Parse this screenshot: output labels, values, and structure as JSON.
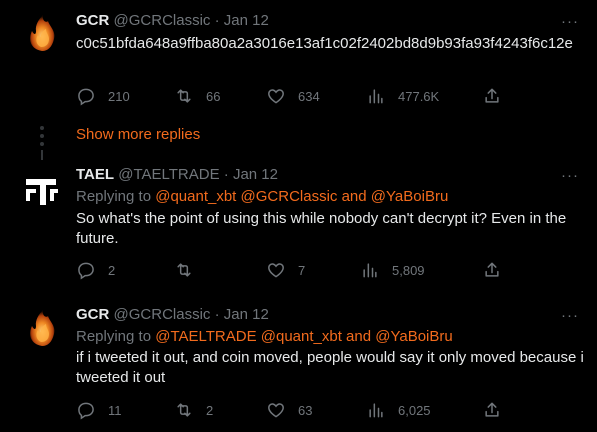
{
  "tweets": [
    {
      "name": "GCR",
      "handle": "@GCRClassic",
      "date": "Jan 12",
      "text": "c0c51bfda648a9ffba80a2a3016e13af1c02f2402bd8d9b93fa93f4243f6c12e",
      "replies": "210",
      "retweets": "66",
      "likes": "634",
      "views": "477.6K"
    },
    {
      "name": "TAEL",
      "handle": "@TAELTRADE",
      "date": "Jan 12",
      "replying_prefix": "Replying to",
      "replying_mention1": "@quant_xbt",
      "replying_mention2": "@GCRClassic",
      "replying_and": "and",
      "replying_mention3": "@YaBoiBru",
      "text": "So what's the point of using this while nobody can't decrypt it? Even in the future.",
      "replies": "2",
      "retweets": "",
      "likes": "7",
      "views": "5,809"
    },
    {
      "name": "GCR",
      "handle": "@GCRClassic",
      "date": "Jan 12",
      "replying_prefix": "Replying to",
      "replying_mention1": "@TAELTRADE",
      "replying_mention2": "@quant_xbt",
      "replying_and": "and",
      "replying_mention3": "@YaBoiBru",
      "text": "if i tweeted it out, and coin moved, people would say it only moved because i tweeted it out",
      "replies": "11",
      "retweets": "2",
      "likes": "63",
      "views": "6,025"
    }
  ],
  "show_more_replies": "Show more replies",
  "dot_separator": "·",
  "more_glyph": "···",
  "colors": {
    "accent": "#f26b1d",
    "muted": "#71767b",
    "text": "#e7e9ea",
    "background": "#000000"
  },
  "icons": [
    "reply-icon",
    "retweet-icon",
    "like-icon",
    "views-icon",
    "share-icon",
    "more-icon",
    "fire-avatar",
    "tael-logo"
  ]
}
